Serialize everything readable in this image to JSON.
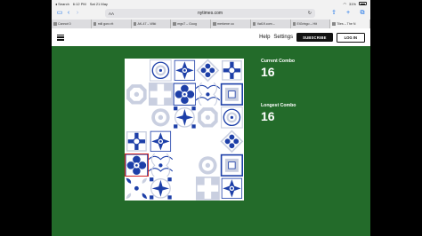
{
  "status_bar": {
    "carrier": "◂ Search",
    "time": "6:12 PM",
    "date": "Sat 21 May",
    "battery": "31%"
  },
  "toolbar": {
    "text_size": "AA",
    "url": "nytimes.com",
    "dots": "•••"
  },
  "tabs": [
    {
      "label": "Cannot 0"
    },
    {
      "label": "mill goro rit"
    },
    {
      "label": "AK-47 – Wiki"
    },
    {
      "label": "mgsT – Goog"
    },
    {
      "label": "merkene co"
    },
    {
      "label": "Vat19.com –"
    },
    {
      "label": "ElGringo – Hit"
    },
    {
      "label": "Tiles – The N"
    }
  ],
  "header": {
    "help": "Help",
    "settings": "Settings",
    "subscribe": "SUBSCRIBE",
    "login": "LOG IN"
  },
  "stats": {
    "current_label": "Current Combo",
    "current_value": "16",
    "longest_label": "Longest Combo",
    "longest_value": "16"
  },
  "colors": {
    "felt": "#236b2a",
    "tile_blue": "#1d3fa8",
    "tile_light": "#c9cfe0",
    "highlight": "#d32626"
  },
  "board": {
    "rows": 6,
    "cols": 5,
    "selected": {
      "row": 4,
      "col": 0
    },
    "cells": [
      [
        "empty",
        "ring-grid",
        "star-medallion",
        "flower-diamond",
        "cross-flower"
      ],
      [
        "grey-octagon",
        "white-cross",
        "dark-quatrefoil",
        "scallop-lattice",
        "border-square"
      ],
      [
        "empty",
        "grey-ring",
        "cross-medallion",
        "grey-octagon",
        "ring-grid"
      ],
      [
        "cross-flower",
        "star-medallion",
        "empty",
        "empty",
        "flower-diamond"
      ],
      [
        "dark-quatrefoil",
        "scallop-lattice",
        "empty",
        "grey-ring",
        "border-square"
      ],
      [
        "corner-fleur",
        "cross-medallion",
        "empty",
        "white-cross",
        "star-medallion"
      ]
    ]
  }
}
